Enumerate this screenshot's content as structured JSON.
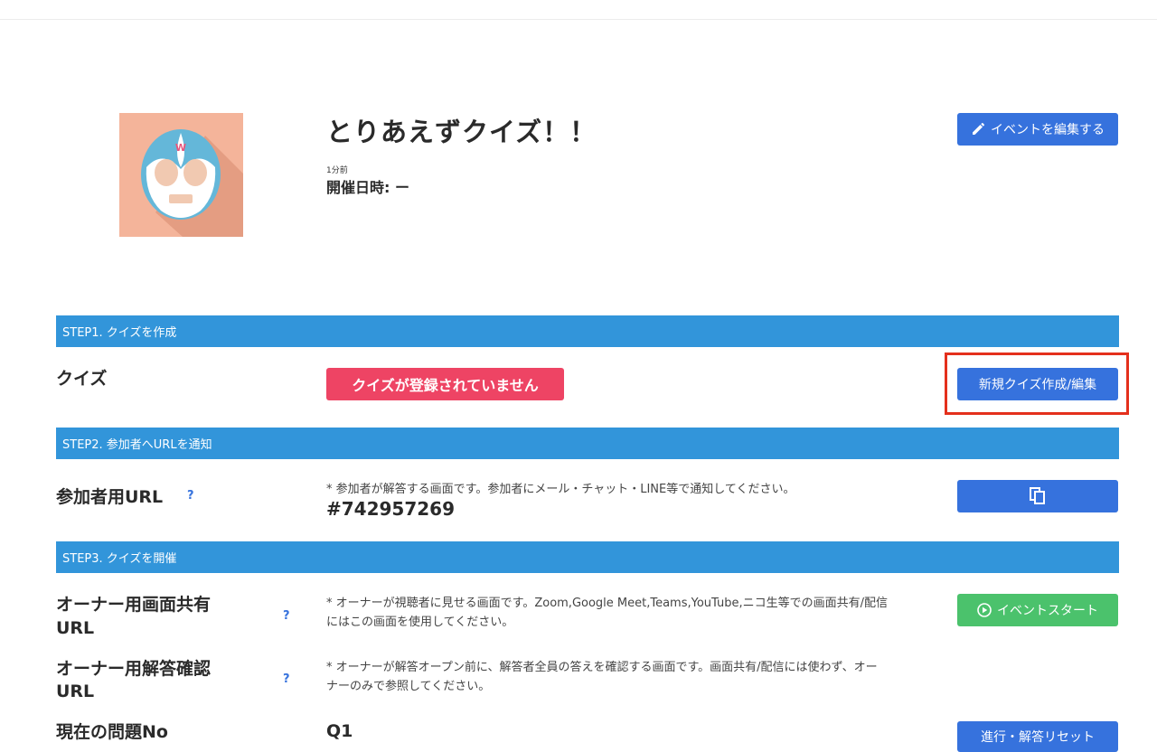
{
  "event": {
    "title": "とりあえずクイズ！！",
    "posted_ago": "1分前",
    "datetime_label": "開催日時: ー",
    "edit_button_label": "イベントを編集する"
  },
  "step1": {
    "header": "STEP1. クイズを作成",
    "quiz_label": "クイズ",
    "quiz_status": "クイズが登録されていません",
    "new_quiz_button_label": "新規クイズ作成/編集"
  },
  "step2": {
    "header": "STEP2. 参加者へURLを通知",
    "participant_url_label": "参加者用URL",
    "help_mark": "?",
    "participant_note": "* 参加者が解答する画面です。参加者にメール・チャット・LINE等で通知してください。",
    "participant_code": "#742957269"
  },
  "step3": {
    "header": "STEP3. クイズを開催",
    "share_url_label_line1": "オーナー用画面共有",
    "share_url_label_line2": "URL",
    "share_note_line1": "* オーナーが視聴者に見せる画面です。Zoom,Google Meet,Teams,YouTube,ニコ生等での画面共有/配信",
    "share_note_line2": "にはこの画面を使用してください。",
    "event_start_button_label": "イベントスタート",
    "confirm_url_label_line1": "オーナー用解答確認",
    "confirm_url_label_line2": "URL",
    "confirm_note_line1": "* オーナーが解答オープン前に、解答者全員の答えを確認する画面です。画面共有/配信には使わず、オー",
    "confirm_note_line2": "ナーのみで参照してください。",
    "current_question_label": "現在の問題No",
    "current_question_value": "Q1",
    "reset_button_label": "進行・解答リセット"
  },
  "colors": {
    "step_bar": "#3295da",
    "primary_button": "#3672dd",
    "start_button": "#4bc26c",
    "status_badge": "#ee4464",
    "highlight_border": "#e4301c"
  }
}
